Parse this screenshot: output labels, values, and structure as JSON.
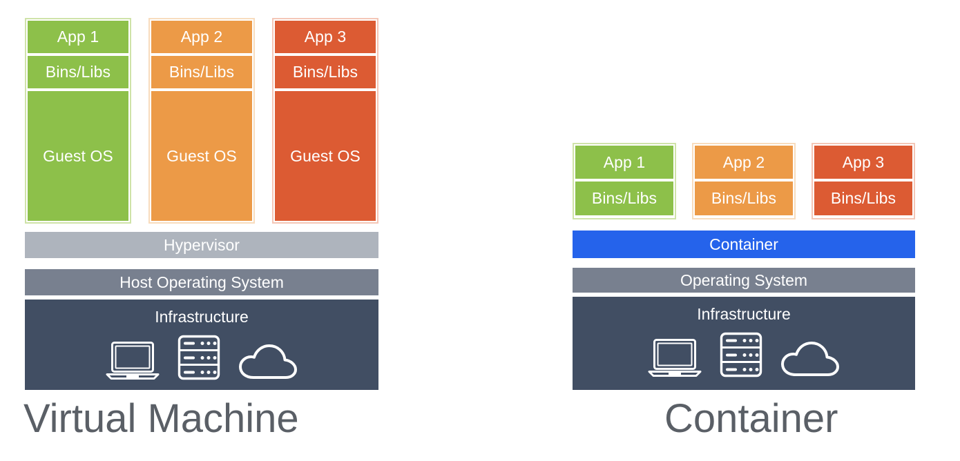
{
  "diagram": {
    "title_left": "Virtual Machine",
    "title_right": "Container",
    "colors": {
      "green": "#8DC04A",
      "orange": "#EC9A47",
      "red": "#DC5B33",
      "hypervisor_gray": "#AEB4BD",
      "os_gray": "#78808F",
      "infrastructure_navy": "#414E63",
      "container_blue": "#2563EB",
      "caption_gray": "#5A5F66"
    }
  },
  "vm": {
    "columns": [
      {
        "app": "App 1",
        "bins": "Bins/Libs",
        "guest": "Guest OS",
        "color": "green"
      },
      {
        "app": "App 2",
        "bins": "Bins/Libs",
        "guest": "Guest OS",
        "color": "orange"
      },
      {
        "app": "App 3",
        "bins": "Bins/Libs",
        "guest": "Guest OS",
        "color": "red"
      }
    ],
    "hypervisor": "Hypervisor",
    "host_os": "Host Operating System",
    "infrastructure": "Infrastructure",
    "icons": [
      "laptop-icon",
      "server-rack-icon",
      "cloud-icon"
    ]
  },
  "container": {
    "columns": [
      {
        "app": "App 1",
        "bins": "Bins/Libs",
        "color": "green"
      },
      {
        "app": "App 2",
        "bins": "Bins/Libs",
        "color": "orange"
      },
      {
        "app": "App 3",
        "bins": "Bins/Libs",
        "color": "red"
      }
    ],
    "container_layer": "Container",
    "operating_system": "Operating System",
    "infrastructure": "Infrastructure",
    "icons": [
      "laptop-icon",
      "server-rack-icon",
      "cloud-icon"
    ]
  }
}
